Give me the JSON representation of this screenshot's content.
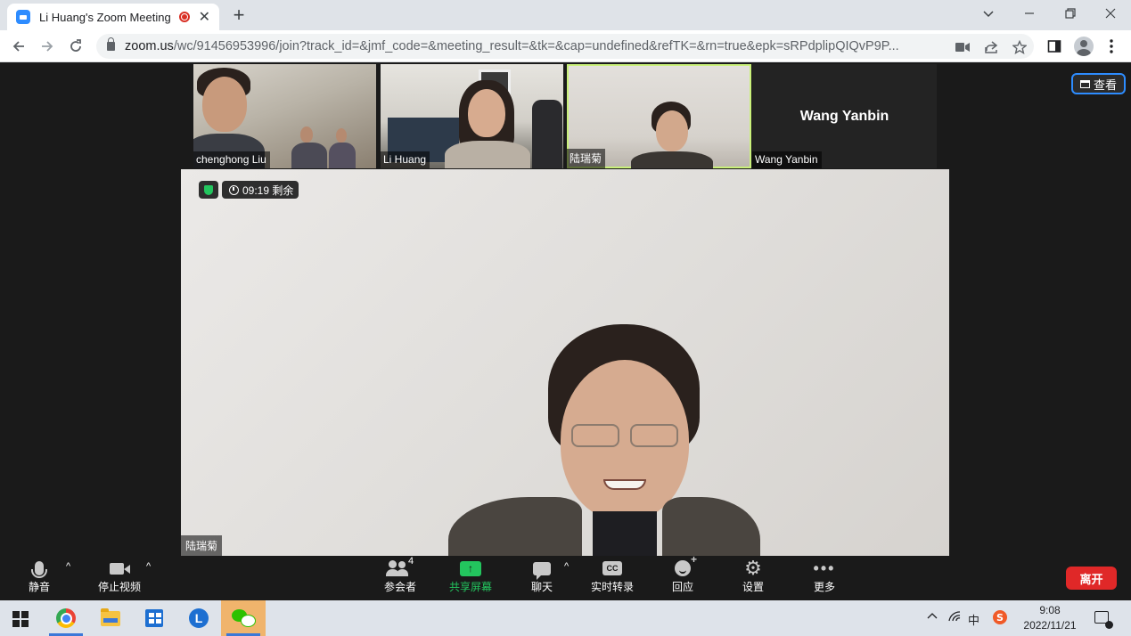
{
  "browser": {
    "tab_title": "Li Huang's Zoom Meeting",
    "new_tab": "+",
    "url_host": "zoom.us",
    "url_path": "/wc/91456953996/join?track_id=&jmf_code=&meeting_result=&tk=&cap=undefined&refTK=&rn=true&epk=sRPdplipQIQvP9P..."
  },
  "gallery": {
    "participants": [
      {
        "name": "chenghong Liu"
      },
      {
        "name": "Li Huang"
      },
      {
        "name": "陆瑞菊"
      },
      {
        "name": "Wang Yanbin",
        "display_name": "Wang Yanbin"
      }
    ],
    "view_button": "查看"
  },
  "main_video": {
    "timer": "09:19 剩余",
    "speaker_name": "陆瑞菊"
  },
  "controls": {
    "mute": "静音",
    "stop_video": "停止视频",
    "participants": "参会者",
    "participants_count": "4",
    "share_screen": "共享屏幕",
    "chat": "聊天",
    "cc_glyph": "CC",
    "captions": "实时转录",
    "reactions": "回应",
    "settings": "设置",
    "more": "更多",
    "leave": "离开"
  },
  "taskbar": {
    "lapp_letter": "L",
    "ime": "中",
    "time": "9:08",
    "date": "2022/11/21"
  },
  "colors": {
    "zoom_blue": "#2d8cff",
    "share_green": "#23c55e",
    "leave_red": "#e02828",
    "active_speaker_outline": "#c9f07a"
  }
}
